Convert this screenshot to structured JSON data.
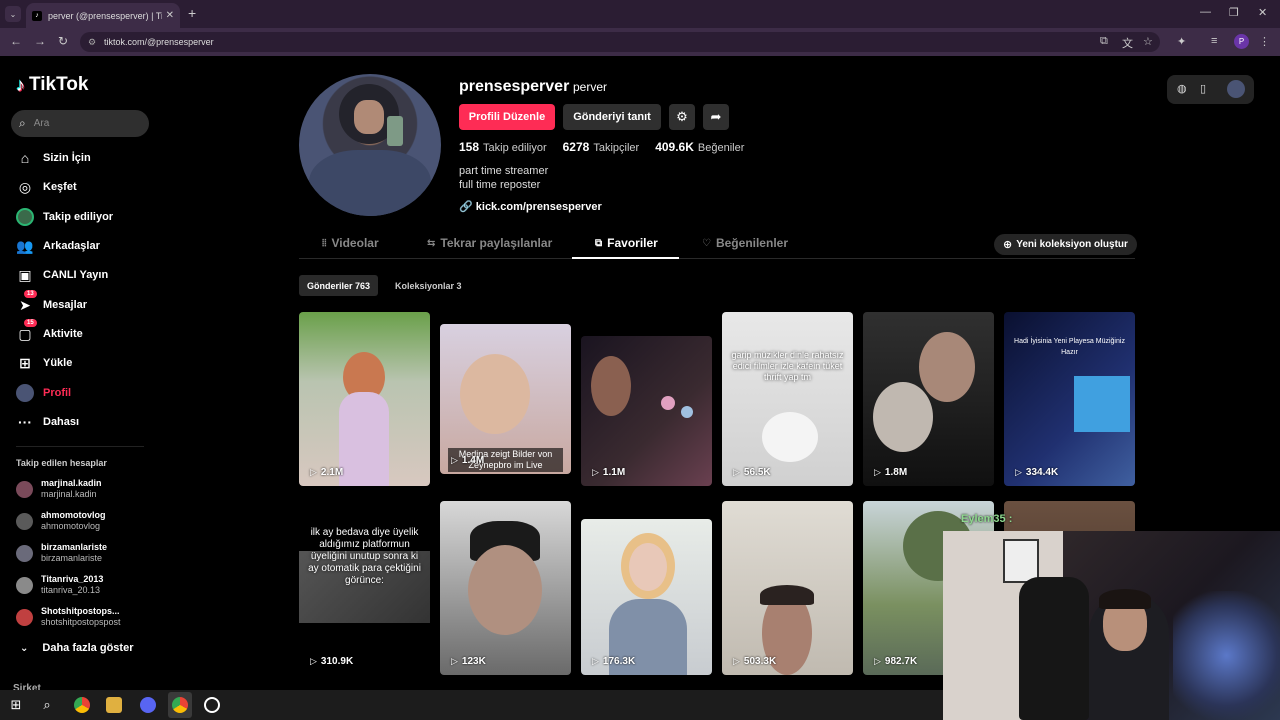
{
  "browser": {
    "tab_title": "perver (@prensesperver) | TikTok",
    "tab_close": "✕",
    "new_tab": "+",
    "url": "tiktok.com/@prensesperver",
    "profile_initial": "P"
  },
  "sidebar": {
    "logo": "TikTok",
    "search_placeholder": "Ara",
    "items": [
      {
        "label": "Sizin İçin",
        "icon": "home-icon"
      },
      {
        "label": "Keşfet",
        "icon": "compass-icon"
      },
      {
        "label": "Takip ediliyor",
        "icon": "following-avatar-icon"
      },
      {
        "label": "Arkadaşlar",
        "icon": "friends-icon"
      },
      {
        "label": "CANLI Yayın",
        "icon": "live-icon"
      },
      {
        "label": "Mesajlar",
        "icon": "messages-icon",
        "badge": "13"
      },
      {
        "label": "Aktivite",
        "icon": "activity-icon",
        "badge": "15"
      },
      {
        "label": "Yükle",
        "icon": "upload-icon"
      },
      {
        "label": "Profil",
        "icon": "profile-avatar-icon"
      },
      {
        "label": "Dahası",
        "icon": "more-dots-icon"
      }
    ],
    "following_header": "Takip edilen hesaplar",
    "accounts": [
      {
        "name": "marjinal.kadin",
        "handle": "marjinal.kadin"
      },
      {
        "name": "ahmomotovlog",
        "handle": "ahmomotovlog"
      },
      {
        "name": "birzamanlariste",
        "handle": "birzamanlariste"
      },
      {
        "name": "Titanriva_2013",
        "handle": "titanriva_20.13"
      },
      {
        "name": "Shotshitpostops...",
        "handle": "shotshitpostopspost"
      }
    ],
    "see_more": "Daha fazla göster",
    "company": "Şirket"
  },
  "profile": {
    "username": "prensesperver",
    "nickname": "perver",
    "edit_button": "Profili Düzenle",
    "promote_button": "Gönderiyi tanıt",
    "following_count": "158",
    "following_label": "Takip ediliyor",
    "followers_count": "6278",
    "followers_label": "Takipçiler",
    "likes_count": "409.6K",
    "likes_label": "Beğeniler",
    "bio_line1": "part time streamer",
    "bio_line2": "full time reposter",
    "link": "kick.com/prensesperver"
  },
  "tabs": [
    {
      "label": "Videolar"
    },
    {
      "label": "Tekrar paylaşılanlar"
    },
    {
      "label": "Favoriler",
      "active": true
    },
    {
      "label": "Beğenilenler"
    }
  ],
  "new_collection": "Yeni koleksiyon oluştur",
  "subtabs": {
    "posts": "Gönderiler 763",
    "collections": "Koleksiyonlar 3"
  },
  "videos": [
    {
      "views": "2.1M"
    },
    {
      "views": "1.4M",
      "caption": "Medina zeigt Bilder von Zeynepbro im Live"
    },
    {
      "views": "1.1M"
    },
    {
      "views": "56.5K",
      "caption": "garip müzikler dinle rahatsız edici filmler izle kafein tüket thrift yap tm"
    },
    {
      "views": "1.8M"
    },
    {
      "views": "334.4K",
      "caption": "Hadi İyisinia Yeni Playesa Müziğiniz Hazır"
    },
    {
      "views": "310.9K",
      "caption": "ilk ay bedava diye üyelik aldığımız platformun üyeliğini unutup sonra ki ay otomatik para çektiğini görünce:"
    },
    {
      "views": "123K"
    },
    {
      "views": "176.3K"
    },
    {
      "views": "503.3K"
    },
    {
      "views": "982.7K"
    },
    {
      "views": ""
    }
  ],
  "stream_overlay": {
    "chat_name": "Eylem35 :"
  }
}
